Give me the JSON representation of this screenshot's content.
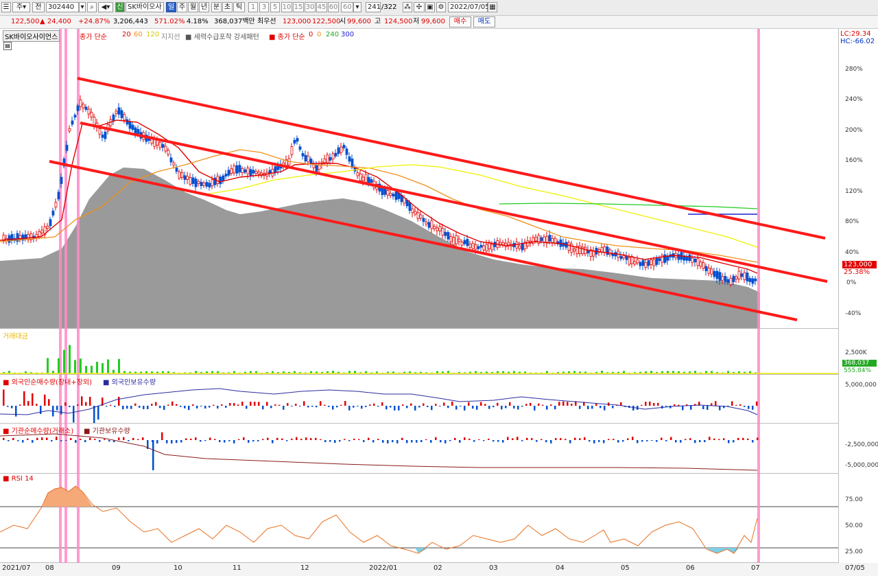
{
  "toolbar": {
    "mode1": "주",
    "mode2": "전",
    "code": "302440",
    "badge": "신",
    "stock_name": "SK바이오사",
    "periods": [
      "일",
      "주",
      "월",
      "년",
      "분",
      "초",
      "틱"
    ],
    "intervals": [
      "1",
      "3",
      "5",
      "10",
      "15",
      "30",
      "45",
      "60"
    ],
    "interval_select": "60",
    "count": "241",
    "total": "/322",
    "date": "2022/07/05"
  },
  "ticker": {
    "price": "122,500",
    "change": "▲ 24,400",
    "change_pct": "+24.87%",
    "volume": "3,206,443",
    "vol_ratio": "571.02%",
    "turnover": "4.18%",
    "amount": "368,037백만",
    "quote_label": "최우선",
    "ask": "123,000",
    "bid": "122,500",
    "open_label": "시",
    "open": "99,600",
    "high_label": "고",
    "high": "124,500",
    "low_label": "저",
    "low": "99,600",
    "buy_button": "매수",
    "sell_button": "매도"
  },
  "price_panel": {
    "stock_label": "SK바이오사이언스",
    "ma_title": "종가 단순",
    "ma_20": "20",
    "ma_60": "60",
    "ma_120": "120",
    "support": "지지선",
    "pattern": "세력수급포착 강세패턴",
    "ma2_title": "종가 단순",
    "ma2_a": "0",
    "ma2_b": "0",
    "ma2_240": "240",
    "ma2_300": "300",
    "lc": "LC:29.34",
    "hc": "HC:-66.02",
    "axis": [
      "280%",
      "240%",
      "200%",
      "160%",
      "120%",
      "80%",
      "40%",
      "0%",
      "-40%"
    ],
    "current_tag": "123,000",
    "current_pct": "25.38%"
  },
  "volume_panel": {
    "title": "거래대금",
    "axis": "2,500K",
    "tag": "368,037",
    "tag_pct": "555.84%"
  },
  "foreign_panel": {
    "title1": "외국인순매수량(장내+장외)",
    "title2": "외국인보유수량",
    "axis": "5,000,000"
  },
  "inst_panel": {
    "title1": "기관순매수량(거래소)",
    "title2": "기관보유수량",
    "axis": [
      "-2,500,000",
      "-5,000,000"
    ]
  },
  "rsi_panel": {
    "title": "RSI 14",
    "axis": [
      "75.00",
      "50.00",
      "25.00"
    ]
  },
  "dates": [
    "2021/07",
    "08",
    "09",
    "10",
    "11",
    "12",
    "2022/01",
    "02",
    "03",
    "04",
    "05",
    "06",
    "07",
    "07/05"
  ],
  "colors": {
    "up": "#e00000",
    "down": "#0050d0",
    "ma20": "#e00000",
    "ma60": "#f0901a",
    "ma120": "#f0f000",
    "ma240": "#22cc22",
    "ma300": "#2020d0",
    "cloud": "#9a9a9a",
    "channel": "#ff1a1a",
    "highlight": "#ff8ac8"
  }
}
